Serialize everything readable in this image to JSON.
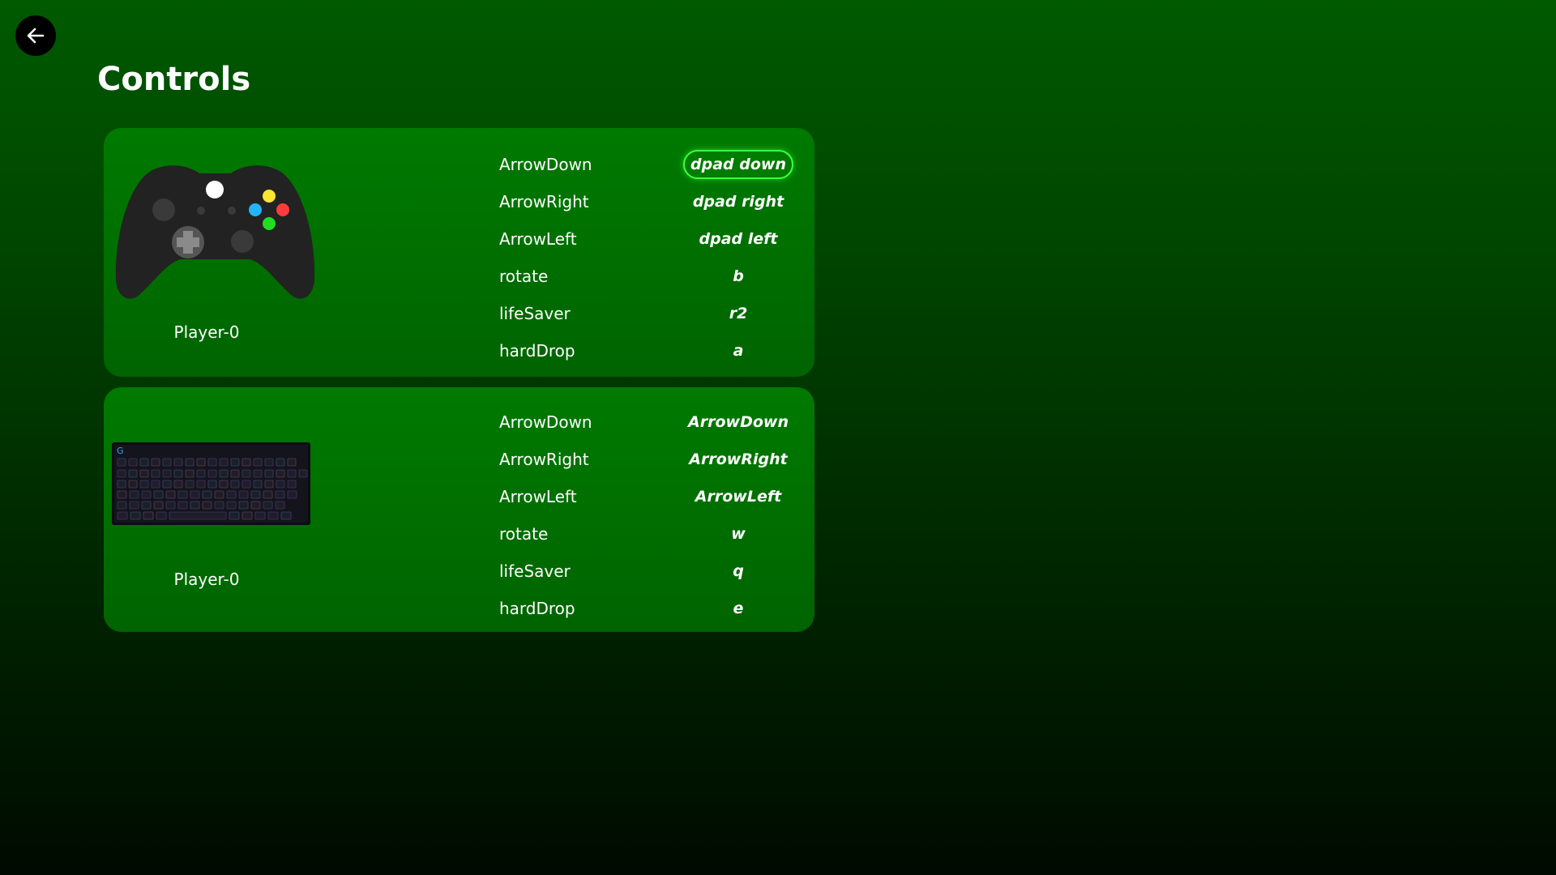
{
  "page": {
    "title": "Controls"
  },
  "colors": {
    "accent": "#3dff3d",
    "card": "#007000",
    "background": "#004400"
  },
  "icons": {
    "back": "arrow-left-icon",
    "gamepad": "gamepad-icon",
    "keyboard": "keyboard-icon"
  },
  "devices": [
    {
      "type": "gamepad",
      "player": "Player-0",
      "bindings": [
        {
          "action": "ArrowDown",
          "key": "dpad down",
          "active": true
        },
        {
          "action": "ArrowRight",
          "key": "dpad right"
        },
        {
          "action": "ArrowLeft",
          "key": "dpad left"
        },
        {
          "action": "rotate",
          "key": "b"
        },
        {
          "action": "lifeSaver",
          "key": "r2"
        },
        {
          "action": "hardDrop",
          "key": "a"
        }
      ]
    },
    {
      "type": "keyboard",
      "player": "Player-0",
      "bindings": [
        {
          "action": "ArrowDown",
          "key": "ArrowDown"
        },
        {
          "action": "ArrowRight",
          "key": "ArrowRight"
        },
        {
          "action": "ArrowLeft",
          "key": "ArrowLeft"
        },
        {
          "action": "rotate",
          "key": "w"
        },
        {
          "action": "lifeSaver",
          "key": "q"
        },
        {
          "action": "hardDrop",
          "key": "e"
        }
      ]
    }
  ]
}
